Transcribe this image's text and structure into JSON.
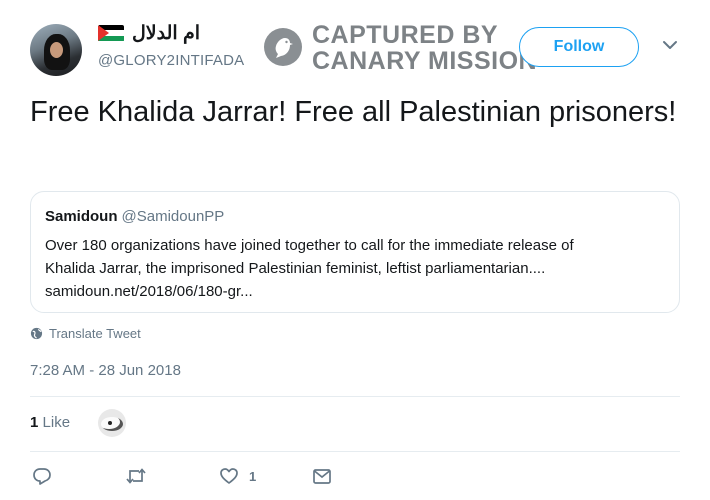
{
  "user": {
    "display_name": "ام الدلال",
    "handle": "@GLORY2INTIFADA",
    "flag_icon": "palestine-flag-icon"
  },
  "watermark": {
    "line1": "CAPTURED BY",
    "line2": "CANARY MISSION"
  },
  "header": {
    "follow_label": "Follow",
    "menu_icon": "chevron-down-icon"
  },
  "tweet": {
    "text": "Free Khalida Jarrar! Free all Palestinian prisoners!",
    "translate_label": "Translate Tweet",
    "timestamp": "7:28 AM - 28 Jun 2018"
  },
  "quote": {
    "name": "Samidoun",
    "handle": "@SamidounPP",
    "line1": "Over 180 organizations have joined together to call for the immediate release of",
    "line2": "Khalida Jarrar, the imprisoned Palestinian feminist, leftist parliamentarian....",
    "line3": "samidoun.net/2018/06/180-gr..."
  },
  "stats": {
    "like_count": "1",
    "like_label": "Like"
  },
  "actions": {
    "like_count": "1"
  },
  "colors": {
    "accent": "#1da1f2",
    "secondary_text": "#657786",
    "border": "#e1e8ed"
  }
}
